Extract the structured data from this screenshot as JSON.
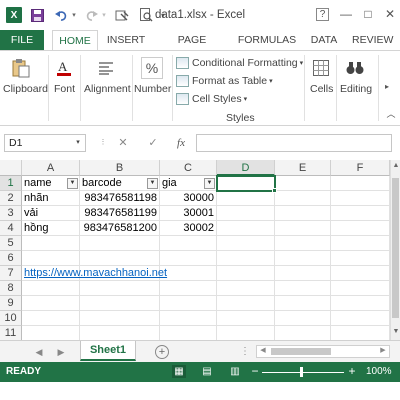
{
  "window": {
    "title": "data1.xlsx - Excel",
    "help": "?",
    "minimize": "—",
    "restore": "□",
    "close": "✕"
  },
  "quick_access": {
    "app_icon": "X"
  },
  "tabs": [
    "FILE",
    "HOME",
    "INSERT",
    "PAGE LAYOUT",
    "FORMULAS",
    "DATA",
    "REVIEW"
  ],
  "ribbon": {
    "clipboard": "Clipboard",
    "font": "Font",
    "alignment": "Alignment",
    "number": "Number",
    "conditional_formatting": "Conditional Formatting",
    "format_as_table": "Format as Table",
    "cell_styles": "Cell Styles",
    "styles_group": "Styles",
    "cells": "Cells",
    "editing": "Editing"
  },
  "formula_bar": {
    "name_box": "D1",
    "cancel": "✕",
    "enter": "✓",
    "fx": "fx",
    "value": ""
  },
  "grid": {
    "columns": [
      "A",
      "B",
      "C",
      "D",
      "E",
      "F"
    ],
    "active_column": "D",
    "rows": [
      "1",
      "2",
      "3",
      "4",
      "5",
      "6",
      "7",
      "8",
      "9",
      "10",
      "11"
    ],
    "active_row": "1",
    "headers": [
      "name",
      "barcode",
      "gia"
    ],
    "data": [
      [
        "nhãn",
        "983476581198",
        "30000"
      ],
      [
        "vải",
        "983476581199",
        "30001"
      ],
      [
        "hồng",
        "983476581200",
        "30002"
      ]
    ],
    "link": "https://www.mavachhanoi.net",
    "selected_cell": "D1"
  },
  "sheets": {
    "active": "Sheet1",
    "add": "+"
  },
  "status": {
    "ready": "READY",
    "zoom": "100%",
    "zoom_minus": "−",
    "zoom_plus": "+"
  },
  "colors": {
    "accent": "#217346",
    "link": "#0563c1"
  }
}
